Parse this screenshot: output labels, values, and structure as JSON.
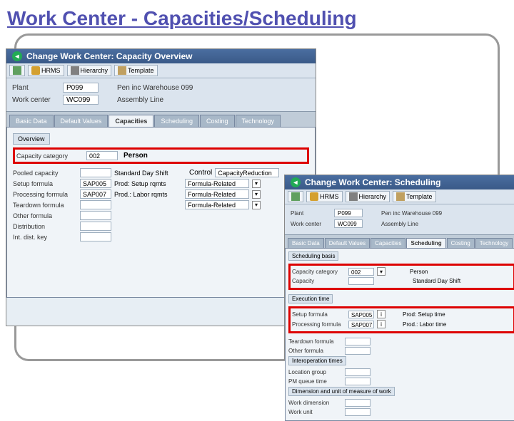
{
  "slide": {
    "title": "Work Center - Capacities/Scheduling"
  },
  "win1": {
    "title": "Change Work Center: Capacity Overview",
    "toolbar": {
      "hrms": "HRMS",
      "hierarchy": "Hierarchy",
      "template": "Template"
    },
    "plant_label": "Plant",
    "plant_value": "P099",
    "plant_desc": "Pen inc Warehouse 099",
    "wc_label": "Work center",
    "wc_value": "WC099",
    "wc_desc": "Assembly Line",
    "tabs": [
      "Basic Data",
      "Default Values",
      "Capacities",
      "Scheduling",
      "Costing",
      "Technology"
    ],
    "active_tab": 2,
    "overview": "Overview",
    "capcat_label": "Capacity category",
    "capcat_value": "002",
    "capcat_desc": "Person",
    "pooled_label": "Pooled capacity",
    "setup_label": "Setup formula",
    "setup_value": "SAP005",
    "setup_desc": "Prod: Setup rqmts",
    "proc_label": "Processing formula",
    "proc_value": "SAP007",
    "proc_desc": "Prod.: Labor rqmts",
    "teardown_label": "Teardown formula",
    "other_label": "Other formula",
    "dist_label": "Distribution",
    "intdist_label": "Int. dist. key",
    "stdshift": "Standard Day Shift",
    "control_label": "Control",
    "control_value": "CapacityReduction",
    "formula_related": "Formula-Related"
  },
  "win2": {
    "title": "Change Work Center: Scheduling",
    "toolbar": {
      "hrms": "HRMS",
      "hierarchy": "Hierarchy",
      "template": "Template"
    },
    "plant_label": "Plant",
    "plant_value": "P099",
    "plant_desc": "Pen inc Warehouse 099",
    "wc_label": "Work center",
    "wc_value": "WC099",
    "wc_desc": "Assembly Line",
    "tabs": [
      "Basic Data",
      "Default Values",
      "Capacities",
      "Scheduling",
      "Costing",
      "Technology"
    ],
    "active_tab": 3,
    "sched_basis": "Scheduling basis",
    "capcat_label": "Capacity category",
    "capcat_value": "002",
    "capcat_desc": "Person",
    "capacity_label": "Capacity",
    "stdshift": "Standard Day Shift",
    "exec_time": "Execution time",
    "setup_label": "Setup formula",
    "setup_value": "SAP005",
    "setup_desc": "Prod: Setup time",
    "proc_label": "Processing formula",
    "proc_value": "SAP007",
    "proc_desc": "Prod.: Labor time",
    "teardown_label": "Teardown formula",
    "other_label": "Other formula",
    "interop": "Interoperation times",
    "locgrp_label": "Location group",
    "pmq_label": "PM queue time",
    "dimdur": "Dimension and unit of measure of work",
    "workdim_label": "Work dimension",
    "workunit_label": "Work unit"
  }
}
